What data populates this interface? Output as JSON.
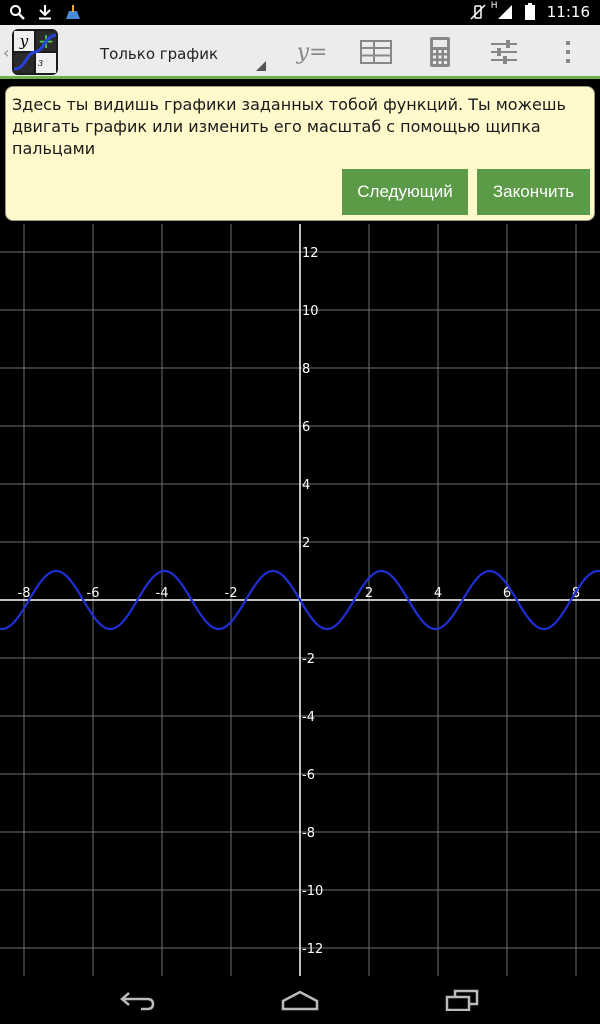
{
  "status_bar": {
    "time": "11:16",
    "left_icons": [
      "search-icon",
      "download-icon",
      "clean-icon"
    ],
    "right_icons": [
      "vibrate-icon",
      "signal-icon",
      "battery-icon"
    ],
    "network_label": "H"
  },
  "action_bar": {
    "view_mode": "Только график",
    "icons": [
      "y-equals-icon",
      "table-icon",
      "calculator-icon",
      "settings-sliders-icon",
      "overflow-menu-icon"
    ],
    "yeq_label": "y=",
    "logo": {
      "y": "y",
      "plus": "+",
      "x3": "x",
      "sup": "3"
    }
  },
  "tutorial": {
    "text": "Здесь ты видишь графики заданных тобой функций. Ты можешь двигать график или изменить его масштаб с помощью щипка пальцами",
    "next_label": "Следующий",
    "finish_label": "Закончить"
  },
  "chart_data": {
    "type": "line",
    "title": "",
    "xlabel": "",
    "ylabel": "",
    "xlim": [
      -8.7,
      8.7
    ],
    "ylim": [
      -13,
      13
    ],
    "x_ticks": [
      -8,
      -6,
      -4,
      -2,
      2,
      4,
      6,
      8
    ],
    "y_ticks": [
      12,
      10,
      8,
      6,
      4,
      2,
      -2,
      -4,
      -6,
      -8,
      -10,
      -12
    ],
    "grid": true,
    "series": [
      {
        "function": "-sin(2x)",
        "color": "#1f2fd6"
      }
    ]
  },
  "colors": {
    "accent": "#6cb04a",
    "button": "#5b9a47",
    "card_bg": "#fff9cc",
    "graph_bg": "#000000",
    "grid": "#6e6e6e",
    "curve": "#1f2fd6"
  },
  "nav_bar": {
    "icons": [
      "back-icon",
      "home-icon",
      "recent-apps-icon"
    ]
  }
}
